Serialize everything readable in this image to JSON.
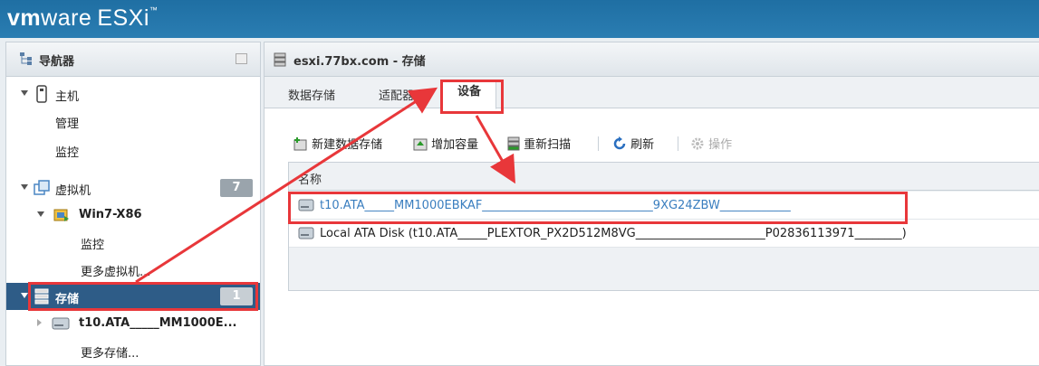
{
  "brand": {
    "vm": "vm",
    "ware": "ware",
    "product": "ESXi",
    "tm": "™"
  },
  "navigator": {
    "title": "导航器",
    "host": {
      "label": "主机",
      "manage": "管理",
      "monitor": "监控"
    },
    "vms": {
      "label": "虚拟机",
      "count": "7",
      "vm1": "Win7-X86",
      "vm1_monitor": "监控",
      "more": "更多虚拟机..."
    },
    "storage": {
      "label": "存储",
      "count": "1",
      "item1": "t10.ATA_____MM1000E...",
      "more": "更多存储..."
    }
  },
  "main": {
    "title": "esxi.77bx.com - 存储",
    "tabs": [
      "数据存储",
      "适配器",
      "设备"
    ],
    "active_tab": "设备",
    "toolbar": {
      "new_datastore": "新建数据存储",
      "increase_capacity": "增加容量",
      "rescan": "重新扫描",
      "refresh": "刷新",
      "actions": "操作"
    },
    "grid": {
      "column_name": "名称",
      "rows": [
        "t10.ATA_____MM1000EBKAF_____________________________9XG24ZBW____________",
        "Local ATA Disk (t10.ATA_____PLEXTOR_PX2D512M8VG______________________P02836113971________)"
      ]
    }
  },
  "colors": {
    "accent": "#2e5c87",
    "highlight": "#e8373a",
    "link": "#3a7ebf"
  }
}
